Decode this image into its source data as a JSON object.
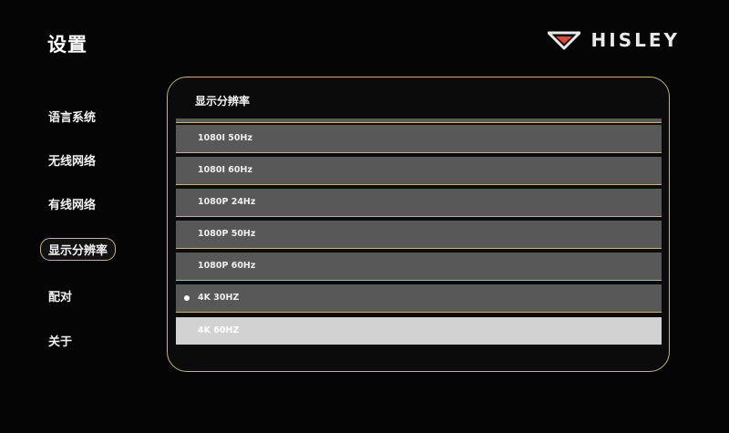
{
  "header": {
    "title": "设置",
    "brand_name": "HISLEY",
    "brand_logo_icon": "hisley-chevron-logo-icon"
  },
  "sidebar": {
    "items": [
      {
        "label": "语言系统"
      },
      {
        "label": "无线网络"
      },
      {
        "label": "有线网络"
      },
      {
        "label": "显示分辨率",
        "active": true
      },
      {
        "label": "配对"
      },
      {
        "label": "关于"
      }
    ]
  },
  "panel": {
    "title": "显示分辨率",
    "options": [
      {
        "label": "1080I 50Hz"
      },
      {
        "label": "1080I 60Hz"
      },
      {
        "label": "1080P 24Hz"
      },
      {
        "label": "1080P 50Hz"
      },
      {
        "label": "1080P 60Hz"
      },
      {
        "label": "4K 30HZ",
        "selected": true
      },
      {
        "label": "4K 60HZ",
        "focused": true
      }
    ]
  },
  "colors": {
    "accent_gold": "#c8b277",
    "option_bg": "#585858",
    "focused_bg": "#d2d2d2",
    "logo_red": "#d94a3a"
  }
}
